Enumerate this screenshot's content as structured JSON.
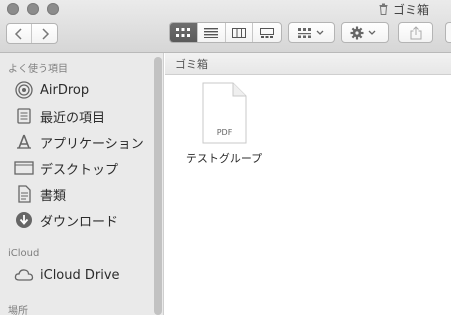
{
  "window": {
    "title": "ゴミ箱",
    "title_icon": "trash-icon"
  },
  "toolbar": {
    "back_icon": "chevron-left-icon",
    "forward_icon": "chevron-right-icon",
    "view_modes": [
      {
        "name": "icon-view",
        "selected": true
      },
      {
        "name": "list-view",
        "selected": false
      },
      {
        "name": "column-view",
        "selected": false
      },
      {
        "name": "gallery-view",
        "selected": false
      }
    ],
    "group_icon": "group-icon",
    "action_icon": "gear-icon",
    "share_icon": "share-icon"
  },
  "sidebar": {
    "favorites_header": "よく使う項目",
    "favorites": [
      {
        "label": "AirDrop",
        "icon": "airdrop-icon"
      },
      {
        "label": "最近の項目",
        "icon": "recents-icon"
      },
      {
        "label": "アプリケーション",
        "icon": "applications-icon"
      },
      {
        "label": "デスクトップ",
        "icon": "desktop-icon"
      },
      {
        "label": "書類",
        "icon": "documents-icon"
      },
      {
        "label": "ダウンロード",
        "icon": "downloads-icon"
      }
    ],
    "icloud_header": "iCloud",
    "icloud": [
      {
        "label": "iCloud Drive",
        "icon": "cloud-icon"
      }
    ],
    "places_header": "場所"
  },
  "main": {
    "path_title": "ゴミ箱",
    "files": [
      {
        "name": "テストグループ",
        "type_label": "PDF",
        "icon": "pdf-file-icon"
      }
    ]
  },
  "colors": {
    "sidebar_bg": "#eaeaea",
    "toolbar_bg": "#d9d9d9",
    "selected_view": "#5e5e5e"
  }
}
